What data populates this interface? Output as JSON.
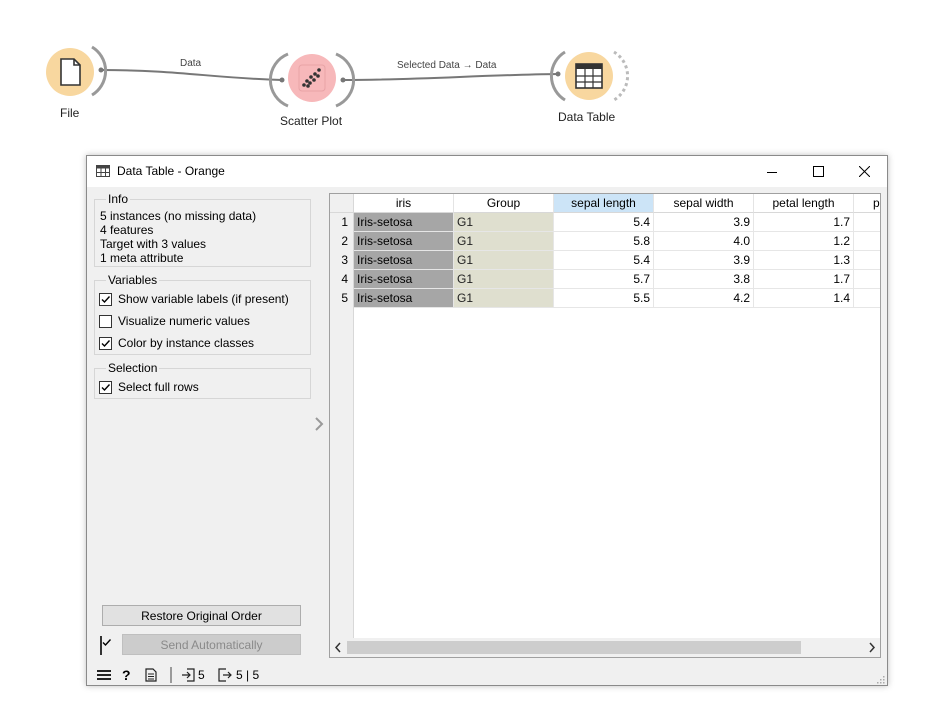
{
  "workflow": {
    "nodes": [
      {
        "label": "File",
        "icon": "file-icon"
      },
      {
        "label": "Scatter Plot",
        "icon": "scatter-plot-icon"
      },
      {
        "label": "Data Table",
        "icon": "data-table-icon"
      }
    ],
    "links": [
      {
        "label": "Data"
      },
      {
        "label": "Selected Data → Data"
      }
    ]
  },
  "window": {
    "title": "Data Table - Orange",
    "controls": {
      "minimize": "minimize-icon",
      "maximize": "maximize-icon",
      "close": "close-icon"
    }
  },
  "info": {
    "title": "Info",
    "lines": [
      "5 instances (no missing data)",
      "4 features",
      "Target with 3 values",
      "1 meta attribute"
    ]
  },
  "variables": {
    "title": "Variables",
    "options": [
      {
        "label": "Show variable labels (if present)",
        "checked": true
      },
      {
        "label": "Visualize numeric values",
        "checked": false
      },
      {
        "label": "Color by instance classes",
        "checked": true
      }
    ]
  },
  "selection": {
    "title": "Selection",
    "options": [
      {
        "label": "Select full rows",
        "checked": true
      }
    ]
  },
  "buttons": {
    "restore": "Restore Original Order",
    "send": "Send Automatically",
    "send_checked": true
  },
  "table": {
    "columns": [
      "iris",
      "Group",
      "sepal length",
      "sepal width",
      "petal length",
      "p"
    ],
    "selected_column": "sepal length",
    "rows": [
      {
        "n": "1",
        "cells": [
          "Iris-setosa",
          "G1",
          "5.4",
          "3.9",
          "1.7"
        ]
      },
      {
        "n": "2",
        "cells": [
          "Iris-setosa",
          "G1",
          "5.8",
          "4.0",
          "1.2"
        ]
      },
      {
        "n": "3",
        "cells": [
          "Iris-setosa",
          "G1",
          "5.4",
          "3.9",
          "1.3"
        ]
      },
      {
        "n": "4",
        "cells": [
          "Iris-setosa",
          "G1",
          "5.7",
          "3.8",
          "1.7"
        ]
      },
      {
        "n": "5",
        "cells": [
          "Iris-setosa",
          "G1",
          "5.5",
          "4.2",
          "1.4"
        ]
      }
    ]
  },
  "status": {
    "input_count": "5",
    "output_count": "5 | 5"
  },
  "colors": {
    "widget_orange": "#f8d79f",
    "widget_pink": "#f7b8ba",
    "class_cell": "#a6a6a6",
    "meta_cell": "#dfdfcf",
    "header_selected": "#cce4f7"
  }
}
